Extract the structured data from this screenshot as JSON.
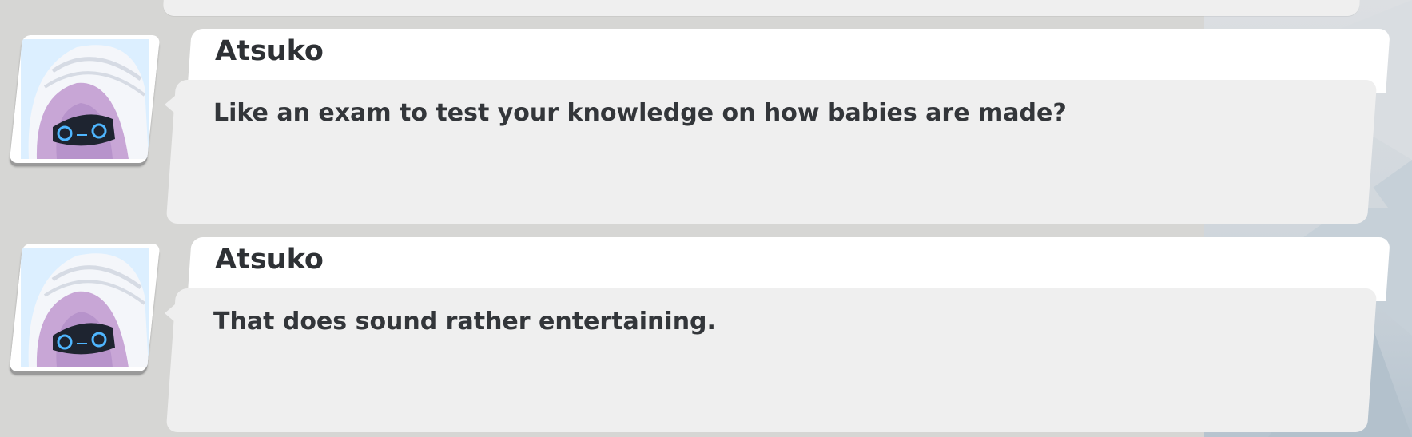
{
  "messages": [
    {
      "speaker": "Atsuko",
      "text": "Like an exam to test your knowledge on how babies are made?",
      "avatar": "atsuko-portrait"
    },
    {
      "speaker": "Atsuko",
      "text": "That does sound rather entertaining.",
      "avatar": "atsuko-portrait"
    }
  ],
  "colors": {
    "background": "#d6d6d4",
    "bubble_header": "#ffffff",
    "bubble_body": "#efefef",
    "text": "#33363a",
    "avatar_hair": "#c8a6d6",
    "avatar_mask_glow": "#4fb6ff"
  }
}
